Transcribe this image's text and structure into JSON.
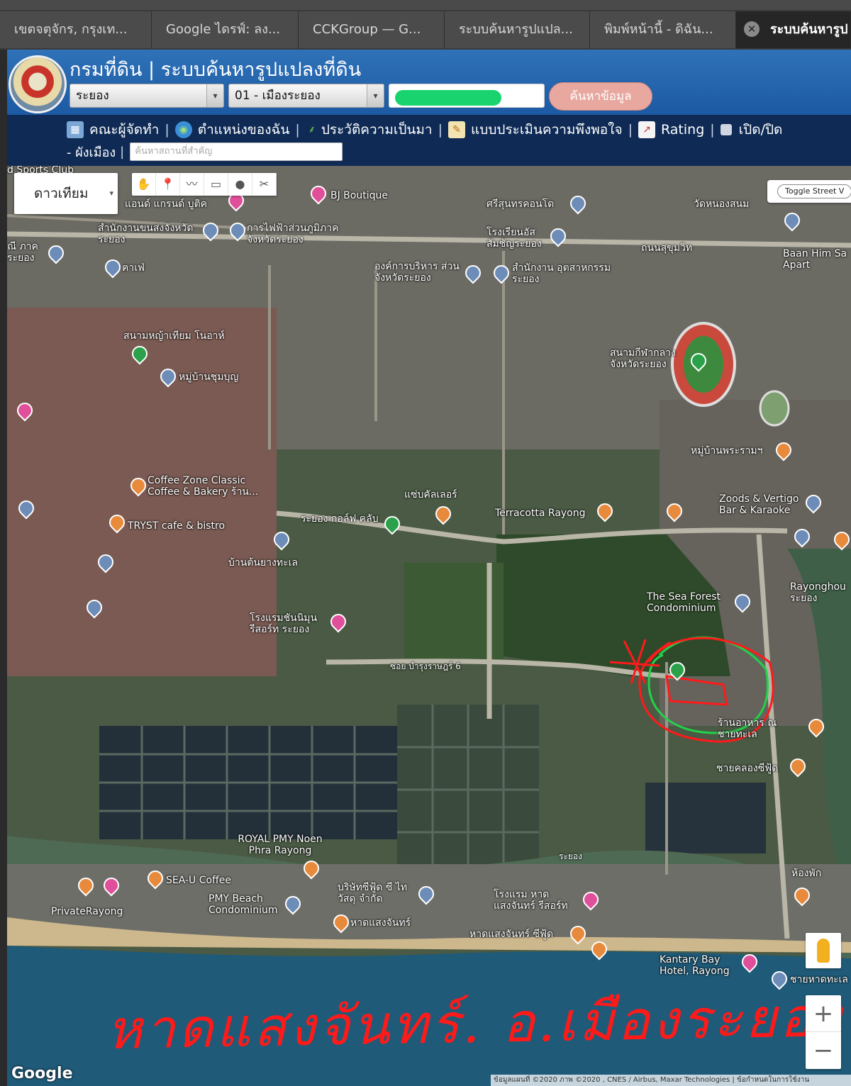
{
  "browser": {
    "tabs": [
      {
        "label": "เขตจตุจักร, กรุงเท..."
      },
      {
        "label": "Google ไดรฟ์: ลง..."
      },
      {
        "label": "CCKGroup — G..."
      },
      {
        "label": "ระบบค้นหารูปแปล..."
      },
      {
        "label": "พิมพ์หน้านี้ - ดิฉัน..."
      },
      {
        "label": "ระบบค้นหารูป"
      }
    ],
    "close_glyph": "✕"
  },
  "header": {
    "title": "กรมที่ดิน | ระบบค้นหารูปแปลงที่ดิน",
    "province_select": "ระยอง",
    "district_select": "01 - เมืองระยอง",
    "search_button": "ค้นหาข้อมูล",
    "select_arrow": "▾"
  },
  "nav": {
    "items": [
      {
        "label": "คณะผู้จัดทำ",
        "icon": "map-icon"
      },
      {
        "label": "ตำแหน่งของฉัน",
        "icon": "globe-icon"
      },
      {
        "label": "ประวัติความเป็นมา",
        "icon": "sprout-icon"
      },
      {
        "label": "แบบประเมินความพึงพอใจ",
        "icon": "form-icon"
      },
      {
        "label": "Rating",
        "icon": "chart-icon"
      },
      {
        "label": "เปิด/ปิด",
        "icon": "checkbox-icon"
      }
    ],
    "separator": "|",
    "row2_prefix": "- ผังเมือง",
    "place_placeholder": "ค้นหาสถานที่สำคัญ"
  },
  "map": {
    "map_type": "ดาวเทียม",
    "dropdown_glyph": "▾",
    "draw_tools": [
      "✋",
      "📍",
      "〰",
      "▭",
      "●",
      "✂"
    ],
    "streetview_toggle": "Toggle Street V",
    "labels": [
      {
        "text": "d Sports Club"
      },
      {
        "text": "BJ Boutique"
      },
      {
        "text": "ศรีสุนทรคอนโด"
      },
      {
        "text": "วัดหนองสนม"
      },
      {
        "text": "แอนด์ แกรนด์ บูติค"
      },
      {
        "text": "สำนักงานขนส่งจังหวัดระยอง"
      },
      {
        "text": "การไฟฟ้าส่วนภูมิภาค จังหวัดระยอง"
      },
      {
        "text": "โรงเรียนอัสสัมชัญระยอง"
      },
      {
        "text": "ถนนสุขุมวิท"
      },
      {
        "text": "Baan Him Sa Apart"
      },
      {
        "text": "ณี ภาค ระยอง"
      },
      {
        "text": "ฅาเฟ่"
      },
      {
        "text": "องค์การบริหาร ส่วนจังหวัดระยอง"
      },
      {
        "text": "สำนักงาน อุตสาหกรรมระยอง"
      },
      {
        "text": "สนามหญ้าเทียม โนอาห์"
      },
      {
        "text": "สนามกีฬากลาง จังหวัดระยอง"
      },
      {
        "text": "หมู่บ้านชุมบุญ"
      },
      {
        "text": "หมู่บ้านพระรามฯ"
      },
      {
        "text": "Coffee Zone Classic Coffee & Bakery ร้าน..."
      },
      {
        "text": "แซ่บคัลเลอร์"
      },
      {
        "text": "Terracotta Rayong"
      },
      {
        "text": "Zoods & Vertigo Bar & Karaoke"
      },
      {
        "text": "TRYST cafe & bistro"
      },
      {
        "text": "ระยอง กอล์ฟ คลับ"
      },
      {
        "text": "บ้านต้นยางทะเล"
      },
      {
        "text": "The Sea Forest Condominium"
      },
      {
        "text": "Rayonghou ระยอง"
      },
      {
        "text": "โรงแรมชันนิมุน รีสอร์ท ระยอง"
      },
      {
        "text": "ซอย บำรุงราษฎร์ 6"
      },
      {
        "text": "ร้านอาหาร ณ ชายทะเล"
      },
      {
        "text": "ชายคลองซีฟู้ด"
      },
      {
        "text": "ROYAL PMY Noen Phra Rayong"
      },
      {
        "text": "SEA-U Coffee"
      },
      {
        "text": "บริษัทซีฟู้ด ซี ไทวัสดุ จำกัด"
      },
      {
        "text": "โรงแรม หาด แสงจันทร์ รีสอร์ท"
      },
      {
        "text": "ห้องพัก"
      },
      {
        "text": "PrivateRayong"
      },
      {
        "text": "PMY Beach Condominium"
      },
      {
        "text": "หาดแสงจันทร์"
      },
      {
        "text": "หาดแสงจันทร์ ซีฟู้ด"
      },
      {
        "text": "Kantary Bay Hotel, Rayong"
      },
      {
        "text": "ชายหาดทะเล"
      },
      {
        "text": "ระยอง"
      }
    ],
    "handwritten_note": "หาดแสงจันทร์. อ.เมืองระยอง",
    "google_logo": "Google",
    "attribution": "ข้อมูลแผนที่ ©2020 ภาพ ©2020 , CNES / Airbus, Maxar Technologies | ข้อกำหนดในการใช้งาน",
    "zoom_in": "+",
    "zoom_out": "−",
    "colors": {
      "annotation_red": "#ff1a1a",
      "annotation_green": "#23d14b",
      "sea": "#1f5a78"
    }
  }
}
